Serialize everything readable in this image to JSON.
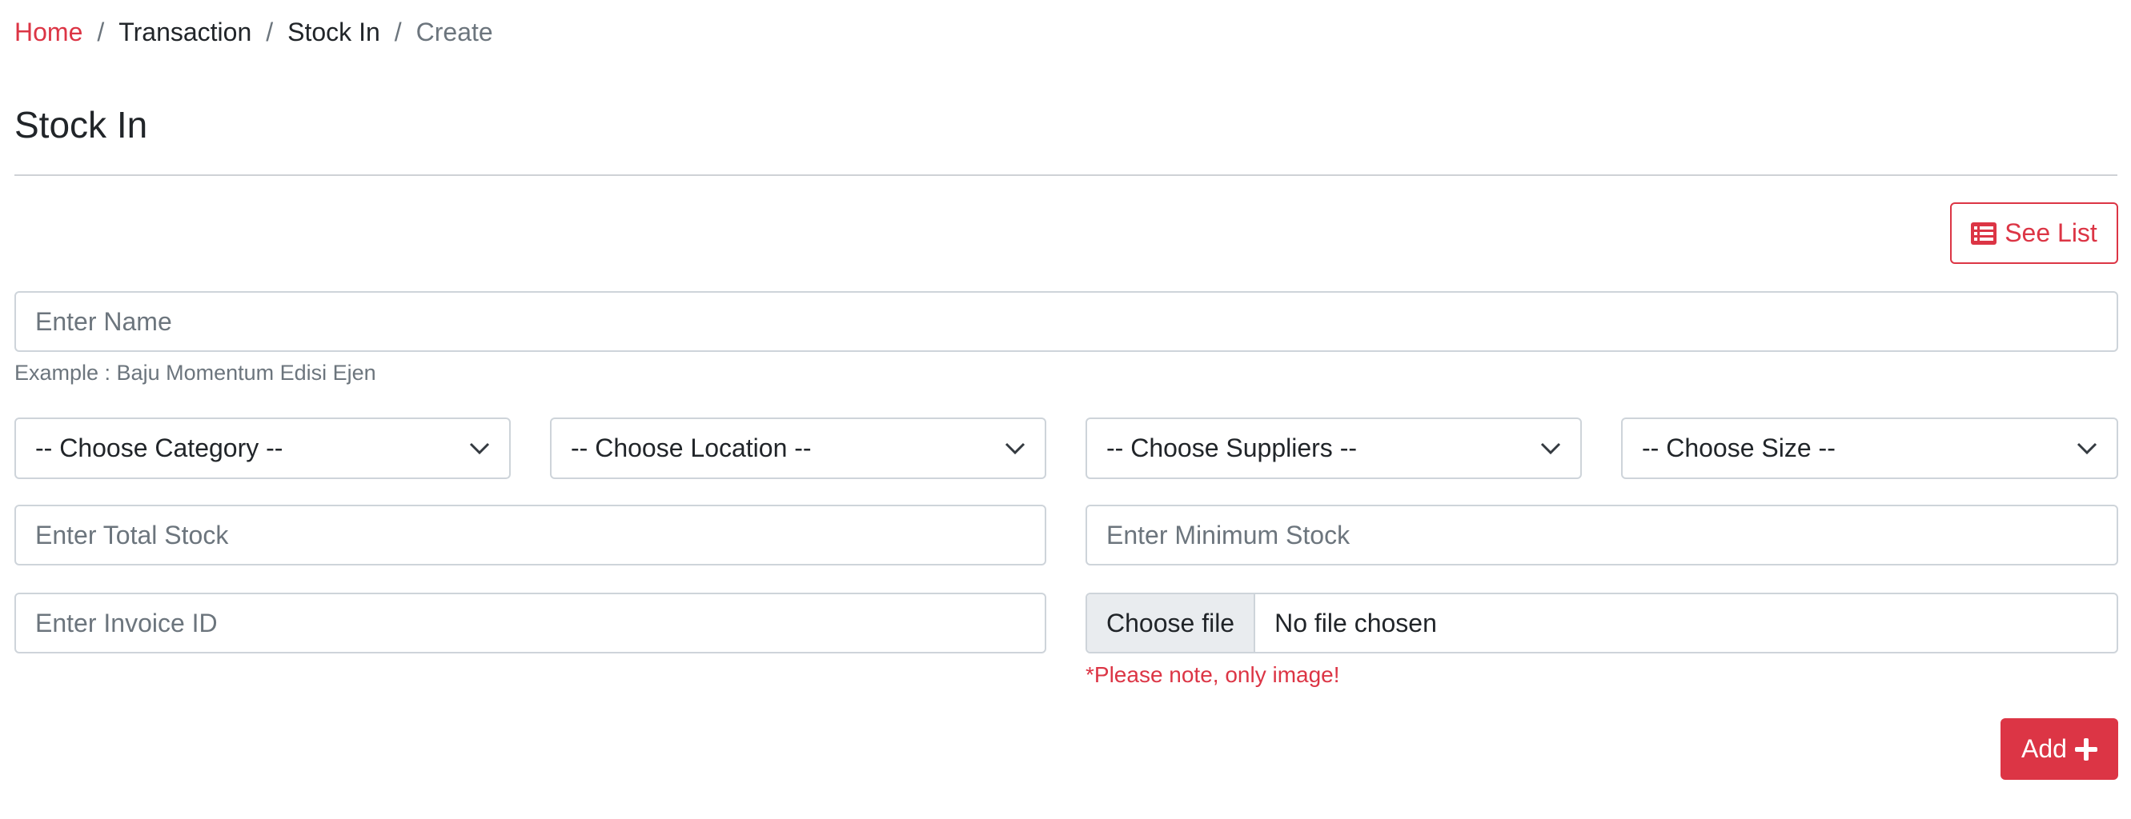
{
  "breadcrumb": {
    "home": "Home",
    "transaction": "Transaction",
    "stock_in": "Stock In",
    "current": "Create",
    "separator": "/"
  },
  "page": {
    "title": "Stock In"
  },
  "actions": {
    "see_list": "See List",
    "add": "Add"
  },
  "form": {
    "name_placeholder": "Enter Name",
    "name_help": "Example : Baju Momentum Edisi Ejen",
    "category": "-- Choose Category --",
    "location": "-- Choose Location --",
    "suppliers": "-- Choose Suppliers --",
    "size": "-- Choose Size --",
    "total_stock_placeholder": "Enter Total Stock",
    "minimum_stock_placeholder": "Enter Minimum Stock",
    "invoice_placeholder": "Enter Invoice ID",
    "file_button": "Choose file",
    "file_status": "No file chosen",
    "file_note": "*Please note, only image!"
  },
  "icons": {
    "see_list": "list-icon",
    "add": "plus-icon",
    "select": "chevron-down-icon"
  },
  "colors": {
    "accent": "#dc3545",
    "muted": "#6c757d",
    "border": "#ced4da"
  }
}
